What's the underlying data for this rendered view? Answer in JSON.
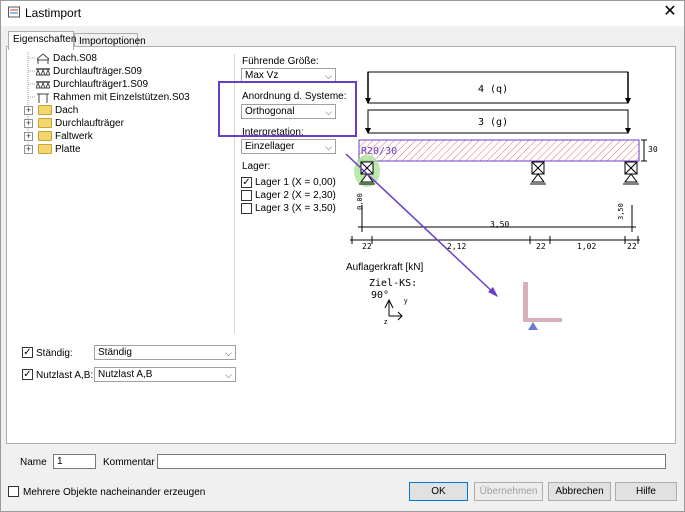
{
  "window": {
    "title": "Lastimport",
    "close_icon": "close-icon"
  },
  "tabs": [
    {
      "label": "Eigenschaften",
      "active": true
    },
    {
      "label": "Importoptionen",
      "active": false
    }
  ],
  "tree": [
    {
      "label": "Dach.S08",
      "icon": "frame-icon",
      "level": 1
    },
    {
      "label": "Durchlaufträger.S09",
      "icon": "beam-icon",
      "level": 1
    },
    {
      "label": "Durchlaufträger1.S09",
      "icon": "beam-icon",
      "level": 1
    },
    {
      "label": "Rahmen mit Einzelstützen.S03",
      "icon": "frame-column-icon",
      "level": 1
    },
    {
      "label": "Dach",
      "icon": "folder-icon",
      "level": 0,
      "expander": "+"
    },
    {
      "label": "Durchlaufträger",
      "icon": "folder-icon",
      "level": 0,
      "expander": "+"
    },
    {
      "label": "Faltwerk",
      "icon": "folder-icon",
      "level": 0,
      "expander": "+"
    },
    {
      "label": "Platte",
      "icon": "folder-icon",
      "level": 0,
      "expander": "+"
    }
  ],
  "options": {
    "fuehrende_label": "Führende Größe:",
    "fuehrende_value": "Max Vz",
    "anordnung_label": "Anordnung d. Systeme:",
    "anordnung_value": "Orthogonal",
    "interpretation_label": "Interpretation:",
    "interpretation_value": "Einzellager",
    "lager_label": "Lager:",
    "lager": [
      {
        "label": "Lager 1 (X = 0,00)",
        "checked": true
      },
      {
        "label": "Lager 2 (X = 2,30)",
        "checked": false
      },
      {
        "label": "Lager 3 (X = 3,50)",
        "checked": false
      }
    ]
  },
  "drawing": {
    "load_1": "4 (q)",
    "load_2": "3 (g)",
    "section": "R20/30",
    "height_dim": "30",
    "left_vert": "0,00",
    "right_vert": "3,50",
    "span_total": "3,50",
    "dims_bottom": [
      "22",
      "2,12",
      "22",
      "1,02",
      "22"
    ],
    "reaction_title": "Auflagerkraft [kN]",
    "ziel_ks": "Ziel-KS:",
    "angle": "90°",
    "axis_y": "y",
    "axis_z": "z",
    "highlight_color": "#6a3dc8",
    "support_highlight": "#a9e39a"
  },
  "loads": {
    "staendig_label": "Ständig:",
    "staendig_checked": true,
    "staendig_value": "Ständig",
    "nutzlast_label": "Nutzlast A,B:",
    "nutzlast_checked": true,
    "nutzlast_value": "Nutzlast A,B"
  },
  "name_row": {
    "name_label": "Name",
    "name_value": "1",
    "kommentar_label": "Kommentar",
    "kommentar_value": ""
  },
  "footer": {
    "multi_label": "Mehrere Objekte nacheinander erzeugen",
    "multi_checked": false,
    "ok": "OK",
    "uebernehmen": "Übernehmen",
    "abbrechen": "Abbrechen",
    "hilfe": "Hilfe"
  }
}
